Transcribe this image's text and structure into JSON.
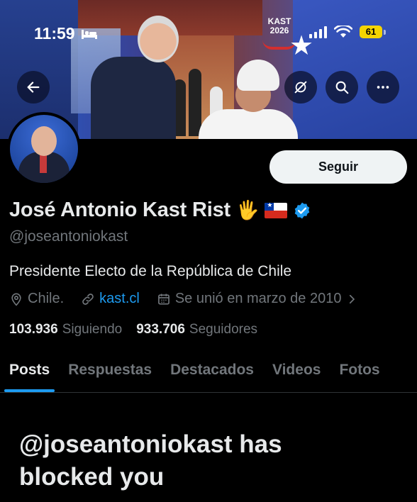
{
  "status_bar": {
    "time": "11:59",
    "battery": "61"
  },
  "banner": {
    "logo_text_line1": "KAST",
    "logo_text_line2": "2026"
  },
  "profile": {
    "follow_label": "Seguir",
    "name": "José Antonio Kast Rist",
    "name_emoji": "🖐",
    "handle": "@joseantoniokast",
    "bio": "Presidente Electo de la República de Chile",
    "location": "Chile.",
    "website": "kast.cl",
    "joined": "Se unió en marzo de 2010",
    "following_count": "103.936",
    "following_label": "Siguiendo",
    "followers_count": "933.706",
    "followers_label": "Seguidores",
    "verified_color": "#1d9bf0"
  },
  "tabs": [
    {
      "label": "Posts",
      "active": true
    },
    {
      "label": "Respuestas",
      "active": false
    },
    {
      "label": "Destacados",
      "active": false
    },
    {
      "label": "Videos",
      "active": false
    },
    {
      "label": "Fotos",
      "active": false
    }
  ],
  "blocked_message": "@joseantoniokast has blocked you",
  "colors": {
    "accent": "#1d9bf0",
    "background": "#000000",
    "secondary_text": "#71767b"
  }
}
